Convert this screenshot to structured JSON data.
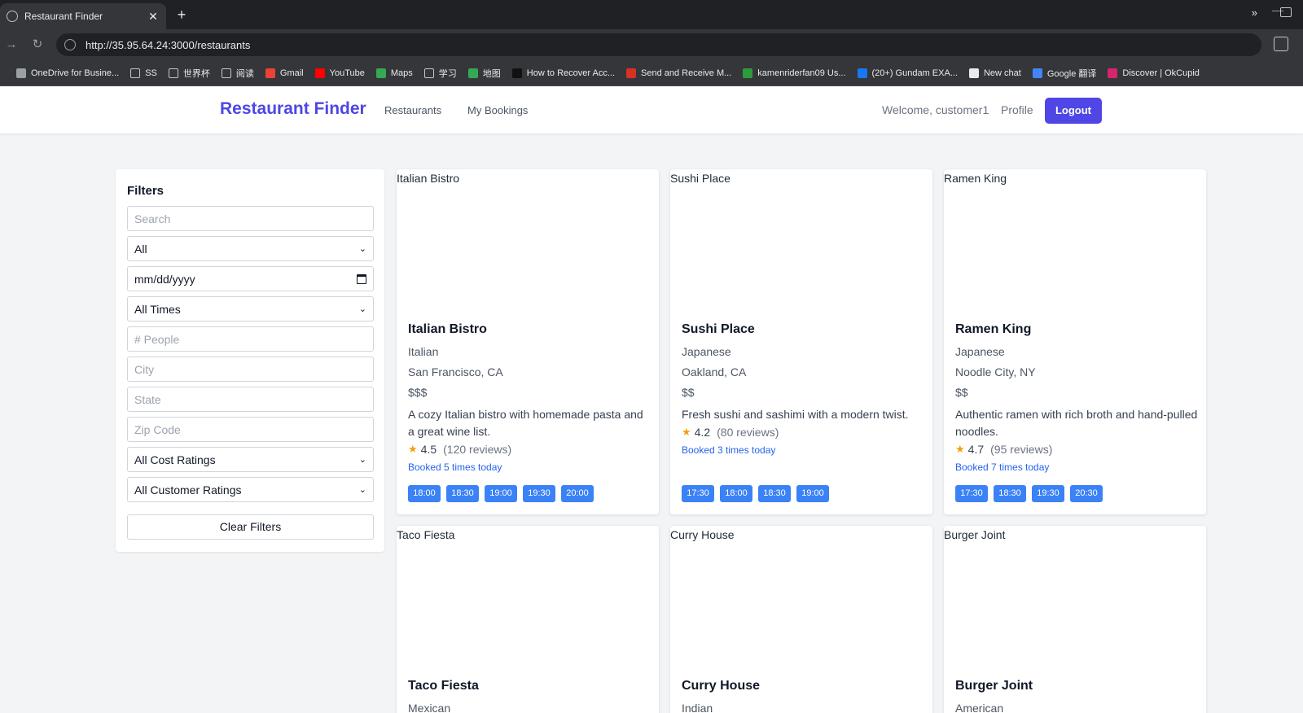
{
  "browser": {
    "tab_title": "Restaurant Finder",
    "tab_close": "✕",
    "new_tab": "+",
    "url": "http://35.95.64.24:3000/restaurants",
    "more": "»",
    "bookmarks": [
      {
        "label": "OneDrive for Busine...",
        "icon": "onedrive-icon",
        "color": "#9aa0a6"
      },
      {
        "label": "SS",
        "icon": "folder-icon",
        "color": ""
      },
      {
        "label": "世界杯",
        "icon": "folder-icon",
        "color": ""
      },
      {
        "label": "阅读",
        "icon": "folder-icon",
        "color": ""
      },
      {
        "label": "Gmail",
        "icon": "gmail-icon",
        "color": "#ea4335"
      },
      {
        "label": "YouTube",
        "icon": "youtube-icon",
        "color": "#ff0000"
      },
      {
        "label": "Maps",
        "icon": "maps-icon",
        "color": "#34a853"
      },
      {
        "label": "学习",
        "icon": "folder-icon",
        "color": ""
      },
      {
        "label": "地图",
        "icon": "maps-icon",
        "color": "#34a853"
      },
      {
        "label": "How to Recover Acc...",
        "icon": "htg-icon",
        "color": "#111111"
      },
      {
        "label": "Send and Receive M...",
        "icon": "wf-icon",
        "color": "#d93025"
      },
      {
        "label": "kamenriderfan09 Us...",
        "icon": "ao3-icon",
        "color": "#2d9c3c"
      },
      {
        "label": "(20+) Gundam EXA...",
        "icon": "facebook-icon",
        "color": "#1877f2"
      },
      {
        "label": "New chat",
        "icon": "openai-icon",
        "color": "#e8eaed"
      },
      {
        "label": "Google 翻译",
        "icon": "google-translate-icon",
        "color": "#4285f4"
      },
      {
        "label": "Discover | OkCupid",
        "icon": "okcupid-icon",
        "color": "#d6246e"
      }
    ]
  },
  "header": {
    "brand": "Restaurant Finder",
    "nav": [
      "Restaurants",
      "My Bookings"
    ],
    "welcome": "Welcome, customer1",
    "profile": "Profile",
    "logout": "Logout",
    "accent": "#4f46e5"
  },
  "filters": {
    "title": "Filters",
    "search_placeholder": "Search",
    "cuisine_selected": "All",
    "date_placeholder": "mm/dd/yyyy",
    "time_selected": "All Times",
    "people_placeholder": "# People",
    "city_placeholder": "City",
    "state_placeholder": "State",
    "zip_placeholder": "Zip Code",
    "cost_selected": "All Cost Ratings",
    "rating_selected": "All Customer Ratings",
    "clear": "Clear Filters"
  },
  "restaurants": [
    {
      "name": "Italian Bistro",
      "cuisine": "Italian",
      "location": "San Francisco, CA",
      "cost": "$$$",
      "description": "A cozy Italian bistro with homemade pasta and a great wine list.",
      "rating": "4.5",
      "reviews": "(120 reviews)",
      "booked": "Booked 5 times today",
      "slots": [
        "18:00",
        "18:30",
        "19:00",
        "19:30",
        "20:00"
      ]
    },
    {
      "name": "Sushi Place",
      "cuisine": "Japanese",
      "location": "Oakland, CA",
      "cost": "$$",
      "description": "Fresh sushi and sashimi with a modern twist.",
      "rating": "4.2",
      "reviews": "(80 reviews)",
      "booked": "Booked 3 times today",
      "slots": [
        "17:30",
        "18:00",
        "18:30",
        "19:00"
      ]
    },
    {
      "name": "Ramen King",
      "cuisine": "Japanese",
      "location": "Noodle City, NY",
      "cost": "$$",
      "description": "Authentic ramen with rich broth and hand-pulled noodles.",
      "rating": "4.7",
      "reviews": "(95 reviews)",
      "booked": "Booked 7 times today",
      "slots": [
        "17:30",
        "18:30",
        "19:30",
        "20:30"
      ]
    },
    {
      "name": "Taco Fiesta",
      "cuisine": "Mexican"
    },
    {
      "name": "Curry House",
      "cuisine": "Indian"
    },
    {
      "name": "Burger Joint",
      "cuisine": "American"
    }
  ]
}
